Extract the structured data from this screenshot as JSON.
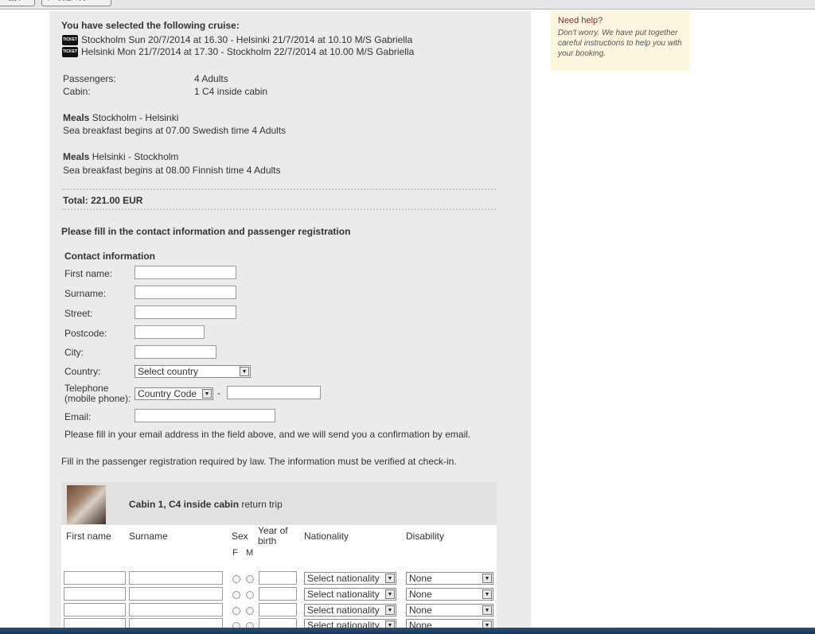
{
  "browser": {
    "back_label": "< 前页",
    "next_label": "下一页进入/关"
  },
  "help": {
    "title": "Need help?",
    "text": "Don't worry. We have put together careful instructions to help you with your booking."
  },
  "cruise": {
    "heading": "You have selected the following cruise:",
    "ticket_icon_text": "TICKET",
    "legs": [
      "Stockholm Sun 20/7/2014 at 16.30 - Helsinki 21/7/2014 at 10.10 M/S Gabriella",
      "Helsinki Mon 21/7/2014 at 17.30 - Stockholm 22/7/2014 at 10.00 M/S Gabriella"
    ],
    "passengers_label": "Passengers:",
    "passengers_value": "4 Adults",
    "cabin_label": "Cabin:",
    "cabin_value": "1 C4 inside cabin",
    "meals": [
      {
        "label": "Meals",
        "route": "Stockholm - Helsinki",
        "detail": "Sea breakfast begins at 07.00 Swedish time 4 Adults"
      },
      {
        "label": "Meals",
        "route": "Helsinki - Stockholm",
        "detail": "Sea breakfast begins at 08.00 Finnish time 4 Adults"
      }
    ],
    "total": "Total: 221.00 EUR"
  },
  "form": {
    "heading": "Please fill in the contact information and passenger registration",
    "contact_heading": "Contact information",
    "first_name_label": "First name:",
    "surname_label": "Surname:",
    "street_label": "Street:",
    "postcode_label": "Postcode:",
    "city_label": "City:",
    "country_label": "Country:",
    "country_value": "Select country",
    "telephone_label_1": "Telephone",
    "telephone_label_2": "(mobile phone):",
    "country_code_value": "Country Code",
    "phone_separator": "-",
    "email_label": "Email:",
    "email_note": "Please fill in your email address in the field above, and we will send you a confirmation by email.",
    "registration_note": "Fill in the passenger registration required by law. The information must be verified at check-in."
  },
  "cabin": {
    "title": "Cabin 1, C4 inside cabin",
    "suffix": "return trip",
    "columns": {
      "first_name": "First name",
      "surname": "Surname",
      "sex": "Sex",
      "year_1": "Year of",
      "year_2": "birth",
      "nationality": "Nationality",
      "disability": "Disability",
      "sex_f": "F",
      "sex_m": "M"
    },
    "rows": [
      {
        "nationality": "Select nationality",
        "disability": "None"
      },
      {
        "nationality": "Select nationality",
        "disability": "None"
      },
      {
        "nationality": "Select nationality",
        "disability": "None"
      },
      {
        "nationality": "Select nationality",
        "disability": "None"
      }
    ]
  }
}
